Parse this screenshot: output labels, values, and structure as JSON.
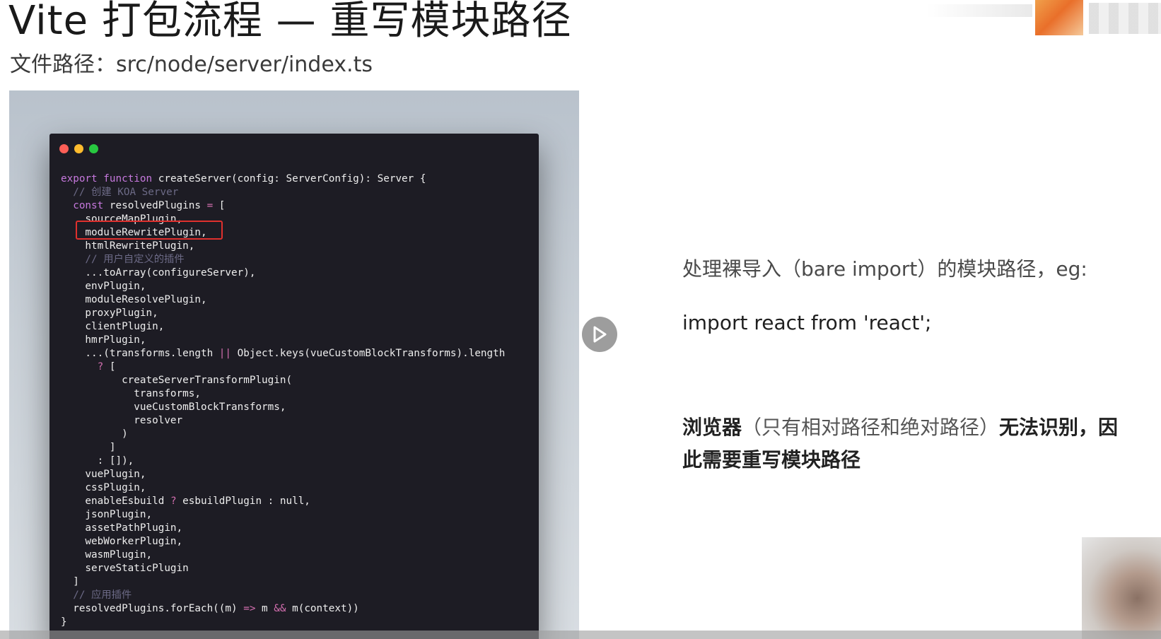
{
  "slide": {
    "title": "Vite 打包流程 — 重写模块路径",
    "subtitle": "文件路径：src/node/server/index.ts"
  },
  "code_lines": [
    "export function createServer(config: ServerConfig): Server {",
    "  // 创建 KOA Server",
    "  const resolvedPlugins = [",
    "    sourceMapPlugin,",
    "    moduleRewritePlugin,",
    "    htmlRewritePlugin,",
    "    // 用户自定义的插件",
    "    ...toArray(configureServer),",
    "    envPlugin,",
    "    moduleResolvePlugin,",
    "    proxyPlugin,",
    "    clientPlugin,",
    "    hmrPlugin,",
    "    ...(transforms.length || Object.keys(vueCustomBlockTransforms).length",
    "      ? [",
    "          createServerTransformPlugin(",
    "            transforms,",
    "            vueCustomBlockTransforms,",
    "            resolver",
    "          )",
    "        ]",
    "      : []),",
    "    vuePlugin,",
    "    cssPlugin,",
    "    enableEsbuild ? esbuildPlugin : null,",
    "    jsonPlugin,",
    "    assetPathPlugin,",
    "    webWorkerPlugin,",
    "    wasmPlugin,",
    "    serveStaticPlugin",
    "  ]",
    "  // 应用插件",
    "  resolvedPlugins.forEach((m) => m && m(context))",
    "}"
  ],
  "description": {
    "line1": "处理裸导入（bare import）的模块路径，eg:",
    "line2": "import react from 'react';",
    "line3_bold_a": "浏览器",
    "line3_light": "（只有相对路径和绝对路径）",
    "line3_bold_b": "无法识别，因",
    "line4": "此需要重写模块路径"
  },
  "colors": {
    "code_bg": "#1d1c24",
    "highlight_border": "#e0302d",
    "keyword": "#c678dd",
    "comment": "#6c6a86",
    "operator": "#d46fb0"
  },
  "icons": {
    "play": "play-icon"
  }
}
